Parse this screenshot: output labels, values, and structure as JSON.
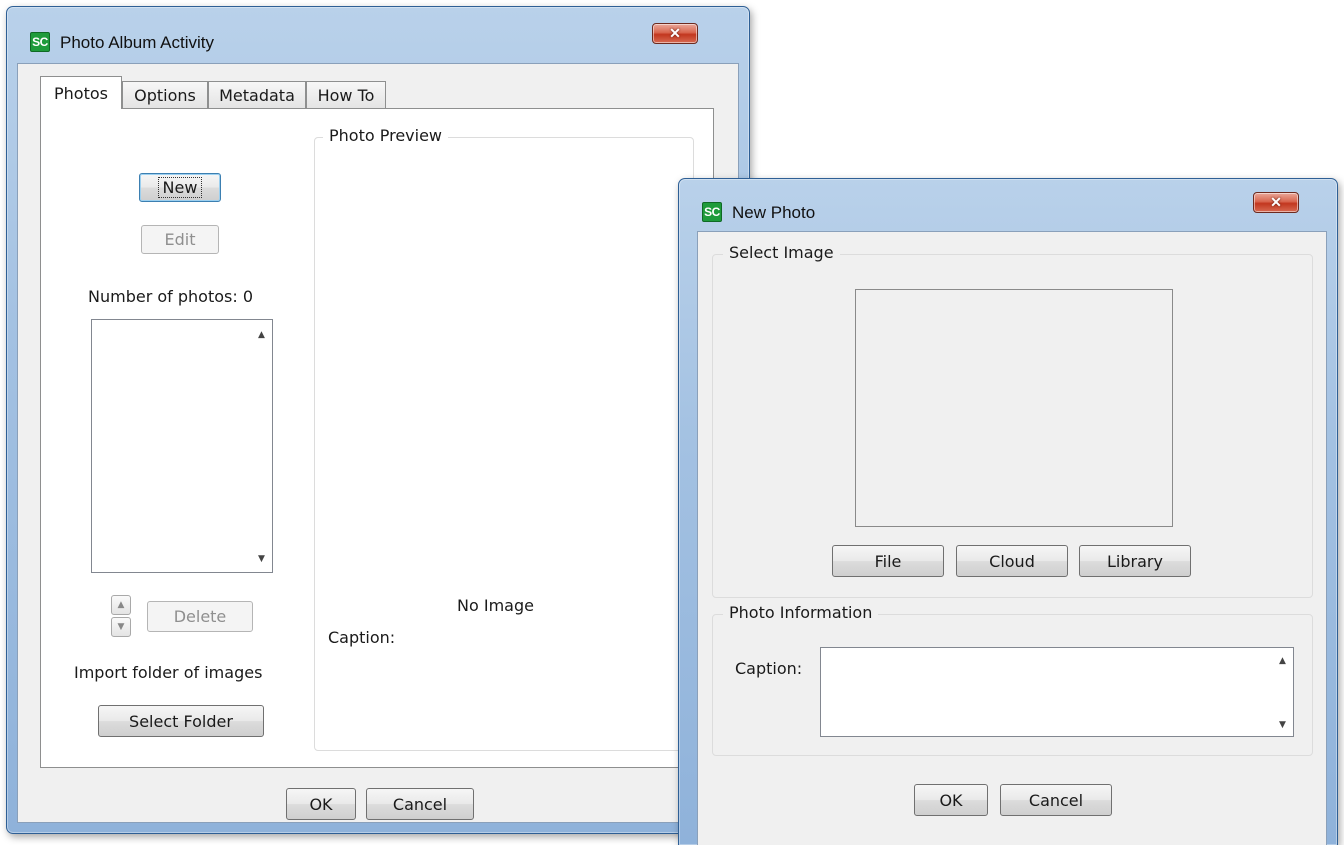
{
  "main_window": {
    "app_icon_text": "SC",
    "title": "Photo Album Activity",
    "close_glyph": "✕",
    "tabs": [
      {
        "label": "Photos",
        "active": true
      },
      {
        "label": "Options",
        "active": false
      },
      {
        "label": "Metadata",
        "active": false
      },
      {
        "label": "How To",
        "active": false
      }
    ],
    "photos_tab": {
      "new_button": "New",
      "edit_button": "Edit",
      "photo_count_text": "Number of photos: 0",
      "delete_button": "Delete",
      "import_label": "Import folder of images",
      "select_folder_button": "Select Folder",
      "preview_group_label": "Photo Preview",
      "no_image_text": "No Image",
      "caption_label": "Caption:"
    },
    "ok_button": "OK",
    "cancel_button": "Cancel"
  },
  "new_photo_dialog": {
    "app_icon_text": "SC",
    "title": "New Photo",
    "close_glyph": "✕",
    "select_image_group_label": "Select Image",
    "file_button": "File",
    "cloud_button": "Cloud",
    "library_button": "Library",
    "photo_info_group_label": "Photo Information",
    "caption_label": "Caption:",
    "ok_button": "OK",
    "cancel_button": "Cancel"
  },
  "icons": {
    "scroll_up": "▲",
    "scroll_down": "▼"
  },
  "colors": {
    "frame_blue": "#a3c1e2",
    "close_red": "#c2371f",
    "app_icon_green": "#1e9b3b",
    "dialog_background": "#f0f0f0"
  }
}
